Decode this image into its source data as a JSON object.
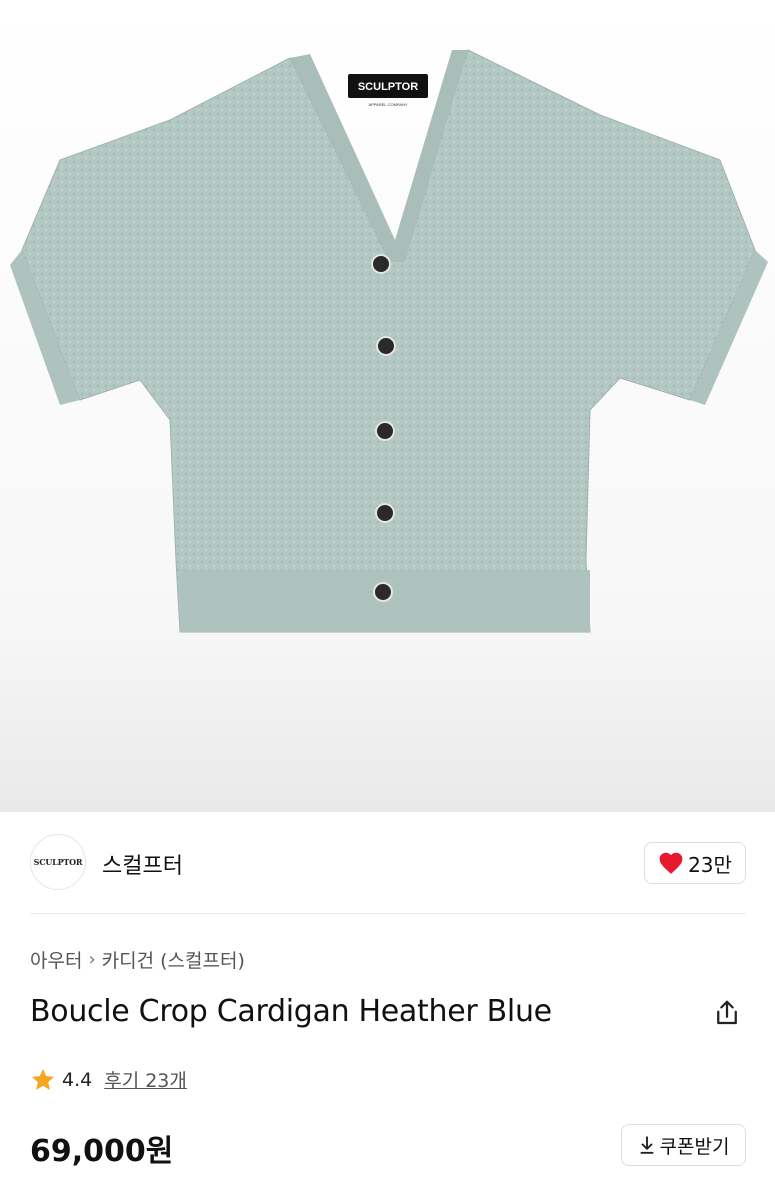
{
  "product_image": {
    "label_text": "SCULPTOR",
    "label_subtext": "APPAREL COMPANY"
  },
  "brand": {
    "logo_text": "SCULPTOR",
    "name": "스컬프터"
  },
  "like": {
    "icon": "heart-icon",
    "count": "23만",
    "color": "#e8192c"
  },
  "breadcrumb": {
    "items": [
      "아우터",
      "카디건 (스컬프터)"
    ],
    "separator": "›"
  },
  "product": {
    "title": "Boucle Crop Cardigan Heather Blue",
    "rating": "4.4",
    "reviews": "후기 23개",
    "price": "69,000원"
  },
  "coupon": {
    "icon": "download-icon",
    "label": "쿠폰받기"
  },
  "colors": {
    "garment": "#b3c7c3",
    "star": "#f5a623"
  }
}
